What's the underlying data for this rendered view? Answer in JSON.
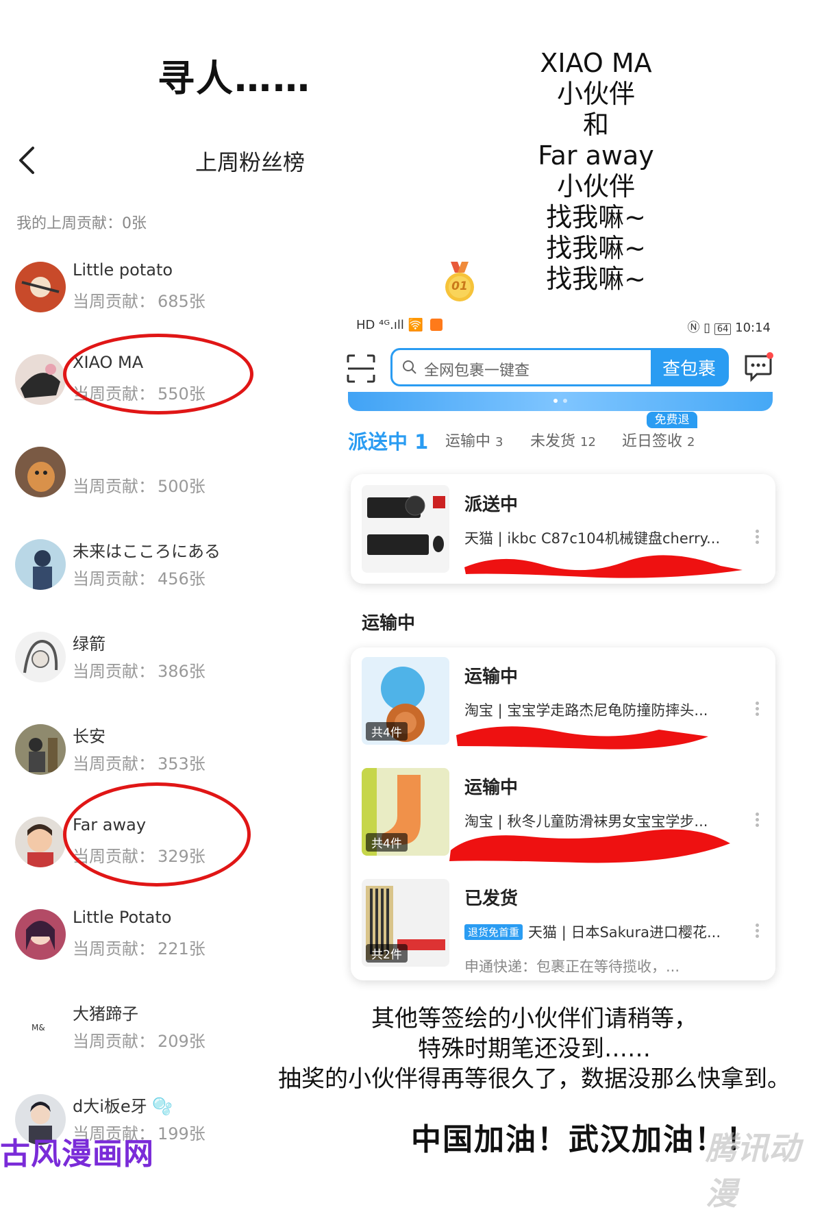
{
  "heading": "寻人……",
  "fan_list": {
    "title": "上周粉丝榜",
    "my_contribution": "我的上周贡献：0张",
    "count_label": "当周贡献：",
    "fans": [
      {
        "name": "Little potato",
        "count": "685张"
      },
      {
        "name": "XIAO MA",
        "count": "550张"
      },
      {
        "name": "",
        "count": "500张"
      },
      {
        "name": "未来はこころにある",
        "count": "456张"
      },
      {
        "name": "绿箭",
        "count": "386张"
      },
      {
        "name": "长安",
        "count": "353张"
      },
      {
        "name": "Far away",
        "count": "329张"
      },
      {
        "name": "Little Potato",
        "count": "221张"
      },
      {
        "name": "大猪蹄子",
        "count": "209张"
      },
      {
        "name": "d大i板e牙",
        "count": "199张"
      }
    ]
  },
  "poem": {
    "lines": [
      "XIAO MA",
      "小伙伴",
      "和",
      "Far away",
      "小伙伴",
      "找我嘛~",
      "找我嘛~",
      "找我嘛~"
    ]
  },
  "medal": "01",
  "status_bar": {
    "left": "HD ⁴ᴳ.ıll 🛜",
    "battery": "64",
    "time": "10:14"
  },
  "app": {
    "search_placeholder": "全网包裹一键查",
    "search_button": "查包裹",
    "free_tag": "免费退",
    "tabs": [
      {
        "label": "派送中",
        "count": "1"
      },
      {
        "label": "运输中",
        "count": "3"
      },
      {
        "label": "未发货",
        "count": "12"
      },
      {
        "label": "近日签收",
        "count": "2"
      }
    ],
    "delivering": {
      "status": "派送中",
      "desc": "天猫 | ikbc C87c104机械键盘cherry..."
    },
    "transit_section": "运输中",
    "transit_items": [
      {
        "status": "运输中",
        "desc": "淘宝 | 宝宝学走路杰尼龟防撞防摔头...",
        "qty": "共4件",
        "sub": "",
        "tag": ""
      },
      {
        "status": "运输中",
        "desc": "淘宝 | 秋冬儿童防滑袜男女宝宝学步...",
        "qty": "共4件",
        "sub": "",
        "tag": ""
      },
      {
        "status": "已发货",
        "desc": "天猫 | 日本Sakura进口樱花...",
        "qty": "共2件",
        "sub": "申通快递：包裹正在等待揽收，...",
        "tag": "退货免首重"
      }
    ]
  },
  "note": {
    "line1": "其他等签绘的小伙伴们请稍等，",
    "line2": "特殊时期笔还没到……",
    "line3": "抽奖的小伙伴得再等很久了，数据没那么快拿到。"
  },
  "cheer": "中国加油！武汉加油！！",
  "watermark_left": "古风漫画网",
  "watermark_right": "腾讯动漫",
  "colors": {
    "accent": "#2a9cf2",
    "circle": "#e01616",
    "scribble": "#ee1111"
  }
}
